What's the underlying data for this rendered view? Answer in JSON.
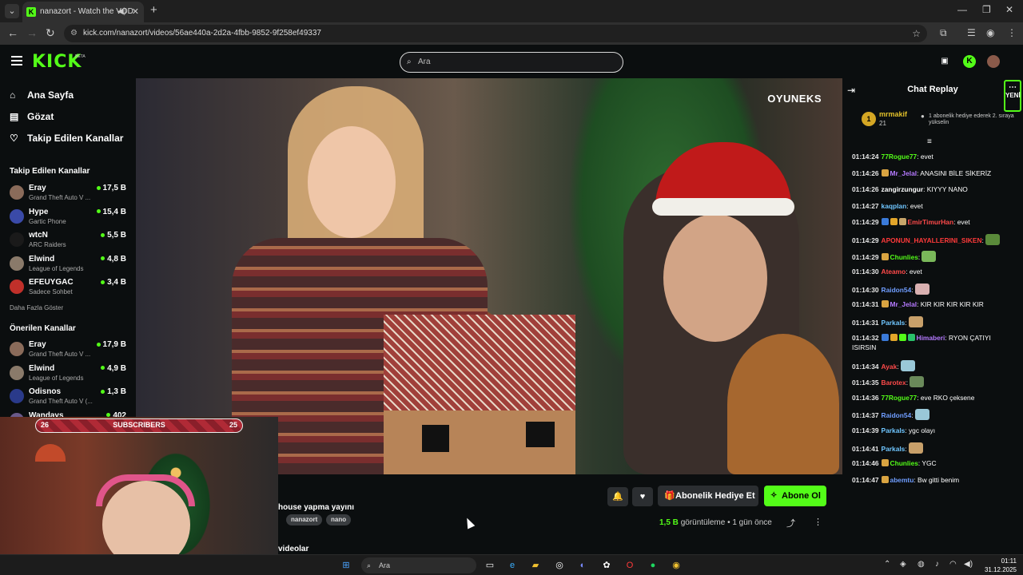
{
  "browser": {
    "tab_title": "nanazort - Watch the VOD",
    "url": "kick.com/nanazort/videos/56ae440a-2d2a-4fbb-9852-9f258ef49337"
  },
  "header": {
    "logo": "KICK",
    "beta": "BETA",
    "search_placeholder": "Ara"
  },
  "sidebar": {
    "nav": [
      {
        "label": "Ana Sayfa",
        "icon": "home-icon"
      },
      {
        "label": "Gözat",
        "icon": "browse-icon"
      },
      {
        "label": "Takip Edilen Kanallar",
        "icon": "heart-icon"
      }
    ],
    "followed_title": "Takip Edilen Kanallar",
    "followed": [
      {
        "name": "Eray",
        "game": "Grand Theft Auto V ...",
        "viewers": "17,5 B",
        "color": "#8a6b5a"
      },
      {
        "name": "Hype",
        "game": "Gartic Phone",
        "viewers": "15,4 B",
        "color": "#3a4aa8"
      },
      {
        "name": "wtcN",
        "game": "ARC Raiders",
        "viewers": "5,5 B",
        "color": "#1a1a1a"
      },
      {
        "name": "Elwind",
        "game": "League of Legends",
        "viewers": "4,8 B",
        "color": "#8a7a6a"
      },
      {
        "name": "EFEUYGAC",
        "game": "Sadece Sohbet",
        "viewers": "3,4 B",
        "color": "#c0302a"
      }
    ],
    "more": "Daha Fazla Göster",
    "recommended_title": "Önerilen Kanallar",
    "recommended": [
      {
        "name": "Eray",
        "game": "Grand Theft Auto V ...",
        "viewers": "17,9 B",
        "color": "#8a6b5a"
      },
      {
        "name": "Elwind",
        "game": "League of Legends",
        "viewers": "4,9 B",
        "color": "#8a7a6a"
      },
      {
        "name": "Odisnos",
        "game": "Grand Theft Auto V (...",
        "viewers": "1,3 B",
        "color": "#2a3a8a"
      },
      {
        "name": "Wandays",
        "game": "",
        "viewers": "402",
        "color": "#6a5a8a"
      }
    ]
  },
  "video": {
    "watermark": "OYUNEKS"
  },
  "overlay": {
    "sub_left": "26",
    "sub_label": "SUBSCRIBERS",
    "sub_right": "25"
  },
  "below": {
    "title": "house yapma yayını",
    "tags": [
      "nanazort",
      "nano"
    ],
    "gift_label": "Abonelik Hediye Et",
    "subscribe_label": "Abone Ol",
    "views_count": "1,5 B",
    "views_label": "görüntüleme",
    "ago": "1 gün önce",
    "videos_heading": "videolar"
  },
  "chat": {
    "title": "Chat Replay",
    "new_label": "YENİ",
    "pinned": {
      "rank": "1",
      "user": "mrmakif",
      "count": "21",
      "text": "1 abonelik hediye ederek 2. sıraya yükselin"
    },
    "messages": [
      {
        "ts": "01:14:24",
        "user": "77Rogue77",
        "color": "#53fc18",
        "text": ": evet",
        "badges": [],
        "emote": ""
      },
      {
        "ts": "01:14:26",
        "user": "Mr_Jelal",
        "color": "#b57aff",
        "text": ": ANASINI BİLE SİKERİZ",
        "badges": [
          "#d9a441"
        ],
        "emote": ""
      },
      {
        "ts": "01:14:26",
        "user": "zangirzungur",
        "color": "#ffffff",
        "text": ": KIYYY NANO",
        "badges": [],
        "emote": ""
      },
      {
        "ts": "01:14:27",
        "user": "kaqplan",
        "color": "#6fc6ff",
        "text": ": evet",
        "badges": [],
        "emote": ""
      },
      {
        "ts": "01:14:29",
        "user": "EmirTimurHan",
        "color": "#ff4a4a",
        "text": ": evet",
        "badges": [
          "#3a7ad9",
          "#e2a52a",
          "#c7a56a"
        ],
        "emote": ""
      },
      {
        "ts": "01:14:29",
        "user": "APONUN_HAYALLERINI_SIKEN",
        "color": "#ff3a3a",
        "text": ":",
        "badges": [],
        "emote": "#5a8a3a"
      },
      {
        "ts": "01:14:29",
        "user": "Chunlies",
        "color": "#53fc18",
        "text": ":",
        "badges": [
          "#d9a441"
        ],
        "emote": "#7ab85a"
      },
      {
        "ts": "01:14:30",
        "user": "Ateamo",
        "color": "#ff4a4a",
        "text": ": evet",
        "badges": [],
        "emote": ""
      },
      {
        "ts": "01:14:30",
        "user": "Raidon54",
        "color": "#6f9dff",
        "text": ":",
        "badges": [],
        "emote": "#d9b0b0"
      },
      {
        "ts": "01:14:31",
        "user": "Mr_Jelal",
        "color": "#b57aff",
        "text": ": KIR KIR KIR KIR KIR",
        "badges": [
          "#d9a441"
        ],
        "emote": ""
      },
      {
        "ts": "01:14:31",
        "user": "Parkals",
        "color": "#6fc6ff",
        "text": ":",
        "badges": [],
        "emote": "#c8a06a"
      },
      {
        "ts": "01:14:32",
        "user": "Himaberi",
        "color": "#b57aff",
        "text": ": RYON ÇATIYI ISIRSIN",
        "badges": [
          "#3a7ad9",
          "#e2a52a",
          "#53fc18",
          "#2ac06a"
        ],
        "emote": ""
      },
      {
        "ts": "01:14:34",
        "user": "Ayak",
        "color": "#ff4a4a",
        "text": ":",
        "badges": [],
        "emote": "#9ac8d8"
      },
      {
        "ts": "01:14:35",
        "user": "Barotex",
        "color": "#ff4a4a",
        "text": ":",
        "badges": [],
        "emote": "#6a8a5a"
      },
      {
        "ts": "01:14:36",
        "user": "77Rogue77",
        "color": "#53fc18",
        "text": ": eve RKO çeksene",
        "badges": [],
        "emote": ""
      },
      {
        "ts": "01:14:37",
        "user": "Raidon54",
        "color": "#6f9dff",
        "text": ":",
        "badges": [],
        "emote": "#9ac8d8"
      },
      {
        "ts": "01:14:39",
        "user": "Parkals",
        "color": "#6fc6ff",
        "text": ": ygc olayı",
        "badges": [],
        "emote": ""
      },
      {
        "ts": "01:14:41",
        "user": "Parkals",
        "color": "#6fc6ff",
        "text": ":",
        "badges": [],
        "emote": "#c8a06a"
      },
      {
        "ts": "01:14:46",
        "user": "Chunlies",
        "color": "#53fc18",
        "text": ": YGC",
        "badges": [
          "#d9a441"
        ],
        "emote": ""
      },
      {
        "ts": "01:14:47",
        "user": "abemtu",
        "color": "#6f9dff",
        "text": ": Bw gitti benim",
        "badges": [
          "#d9a441"
        ],
        "emote": ""
      }
    ]
  },
  "taskbar": {
    "search": "Ara",
    "time": "01:11",
    "date": "31.12.2025"
  }
}
